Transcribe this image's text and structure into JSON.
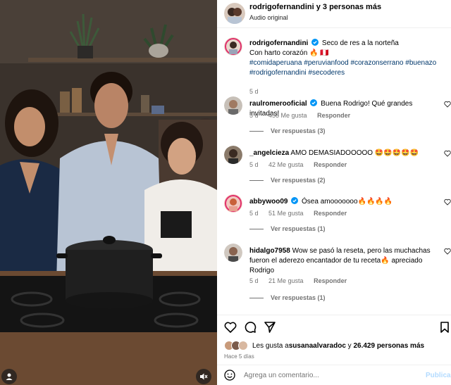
{
  "post": {
    "owner": "rodrigofernandini",
    "collab_suffix": "y 3 personas más",
    "audio": "Audio original"
  },
  "caption": {
    "username": "rodrigofernandini",
    "line1": "Seco de res a la norteña",
    "line2": "Con harto corazón 🔥 🇵🇪",
    "hashtags": "#comidaperuana #peruvianfood #corazonserrano #buenazo #rodrigofernandini #secoderes",
    "time": "5 d"
  },
  "comments": [
    {
      "username": "raulromerooficial",
      "verified": true,
      "text": "Buena Rodrigo! Qué grandes invitadas!",
      "time": "5 d",
      "likes": "458 Me gusta",
      "reply": "Responder",
      "replies": "Ver respuestas (3)"
    },
    {
      "username": "_angelcieza",
      "verified": false,
      "text": "AMO DEMASIADOOOOO 🤩🤩🤩🤩🤩",
      "time": "5 d",
      "likes": "42 Me gusta",
      "reply": "Responder",
      "replies": "Ver respuestas (2)"
    },
    {
      "username": "abbywoo09",
      "verified": true,
      "text": "Ósea amooooooo🔥🔥🔥🔥",
      "time": "5 d",
      "likes": "51 Me gusta",
      "reply": "Responder",
      "replies": "Ver respuestas (1)"
    },
    {
      "username": "hidalgo7958",
      "verified": false,
      "text": "Wow se pasó la reseta, pero las muchachas fueron el aderezo encantador de tu receta🔥 apreciado Rodrigo",
      "time": "5 d",
      "likes": "21 Me gusta",
      "reply": "Responder",
      "replies": "Ver respuestas (1)"
    }
  ],
  "likes_summary": {
    "prefix": "Les gusta a ",
    "first_user": "susanaalvaradoc",
    "middle": " y ",
    "count": "26.429 personas más"
  },
  "posted_ago": "Hace 5 días",
  "comment_box": {
    "placeholder": "Agrega un comentario...",
    "publish": "Publicar"
  },
  "colors": {
    "verified": "#0095f6",
    "link": "#00376b",
    "muted": "#737373",
    "publish_disabled": "#b3dbff"
  },
  "icons": {
    "like": "heart-icon",
    "comment": "comment-icon",
    "share": "send-icon",
    "save": "bookmark-icon",
    "emoji": "smiley-icon",
    "mute": "speaker-muted-icon",
    "tags": "user-tag-icon"
  }
}
